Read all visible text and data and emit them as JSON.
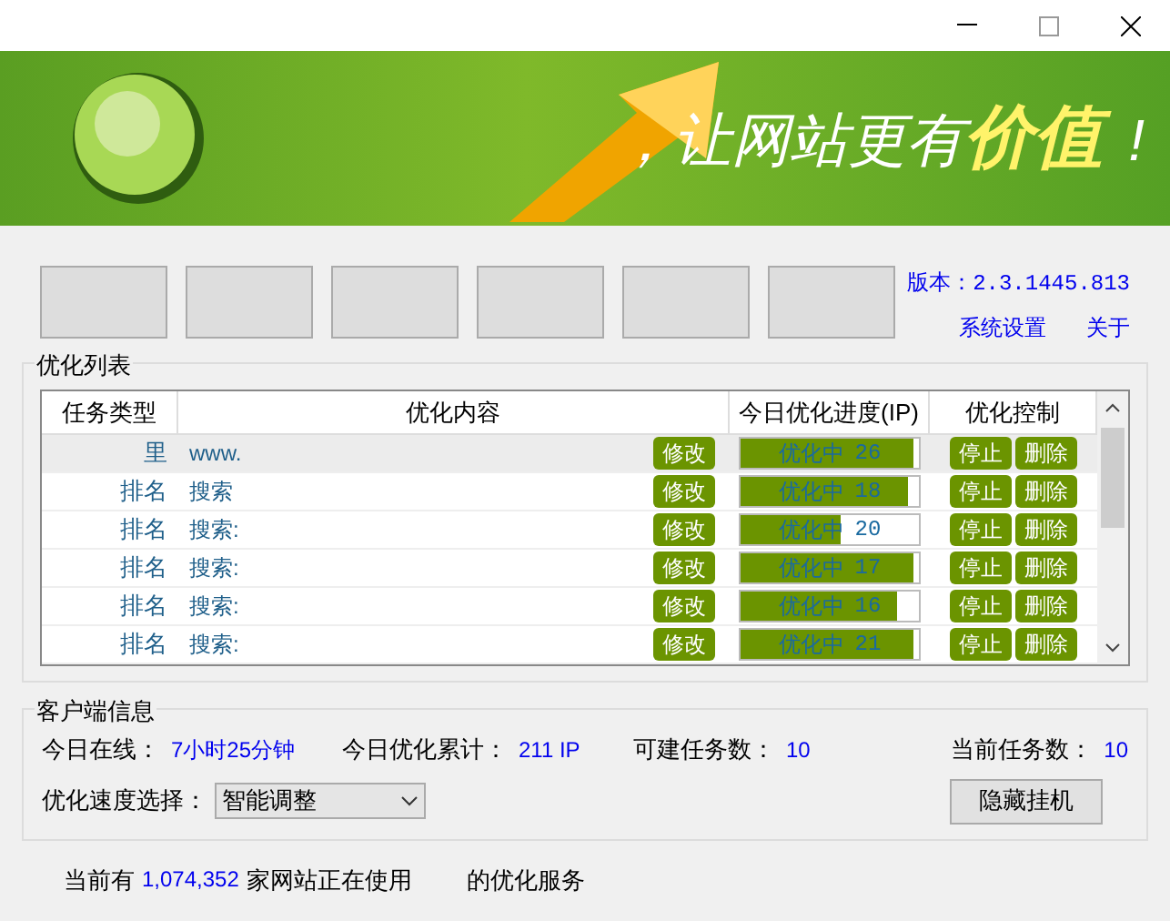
{
  "banner": {
    "slogan": "，让网站更有",
    "highlight": "价值",
    "exclaim": "!"
  },
  "version": {
    "label": "版本：",
    "value": "2.3.1445.813"
  },
  "links": [
    "系统设置",
    "关于"
  ],
  "list_group": {
    "title": "优化列表"
  },
  "table": {
    "columns": [
      "任务类型",
      "优化内容",
      "今日优化进度(IP)",
      "优化控制"
    ],
    "rows": [
      {
        "type": "里",
        "content": "www.",
        "edit": "修改",
        "status": "优化中",
        "count": "26",
        "level": 0.97,
        "stop": "停止",
        "delete": "删除",
        "selected": true
      },
      {
        "type": "排名",
        "content": "搜索",
        "edit": "修改",
        "status": "优化中",
        "count": "18",
        "level": 0.94,
        "stop": "停止",
        "delete": "删除",
        "selected": false
      },
      {
        "type": "排名",
        "content": "搜索:",
        "edit": "修改",
        "status": "优化中",
        "count": "20",
        "level": 0.56,
        "stop": "停止",
        "delete": "删除",
        "selected": false
      },
      {
        "type": "排名",
        "content": "搜索:",
        "edit": "修改",
        "status": "优化中",
        "count": "17",
        "level": 0.97,
        "stop": "停止",
        "delete": "删除",
        "selected": false
      },
      {
        "type": "排名",
        "content": "搜索:",
        "edit": "修改",
        "status": "优化中",
        "count": "16",
        "level": 0.88,
        "stop": "停止",
        "delete": "删除",
        "selected": false
      },
      {
        "type": "排名",
        "content": "搜索:",
        "edit": "修改",
        "status": "优化中",
        "count": "21",
        "level": 0.97,
        "stop": "停止",
        "delete": "删除",
        "selected": false
      }
    ]
  },
  "client_group": {
    "title": "客户端信息",
    "stats": [
      {
        "label": "今日在线：",
        "value": "7小时25分钟"
      },
      {
        "label": "今日优化累计：",
        "value": "211 IP"
      },
      {
        "label": "可建任务数：",
        "value": "10"
      },
      {
        "label": "当前任务数：",
        "value": "10"
      }
    ],
    "speed_label": "优化速度选择：",
    "speed_value": "智能调整",
    "hide_button": "隐藏挂机"
  },
  "footer": {
    "prefix": "当前有",
    "count": "1,074,352",
    "middle": "家网站正在使用",
    "suffix": "的优化服务"
  }
}
